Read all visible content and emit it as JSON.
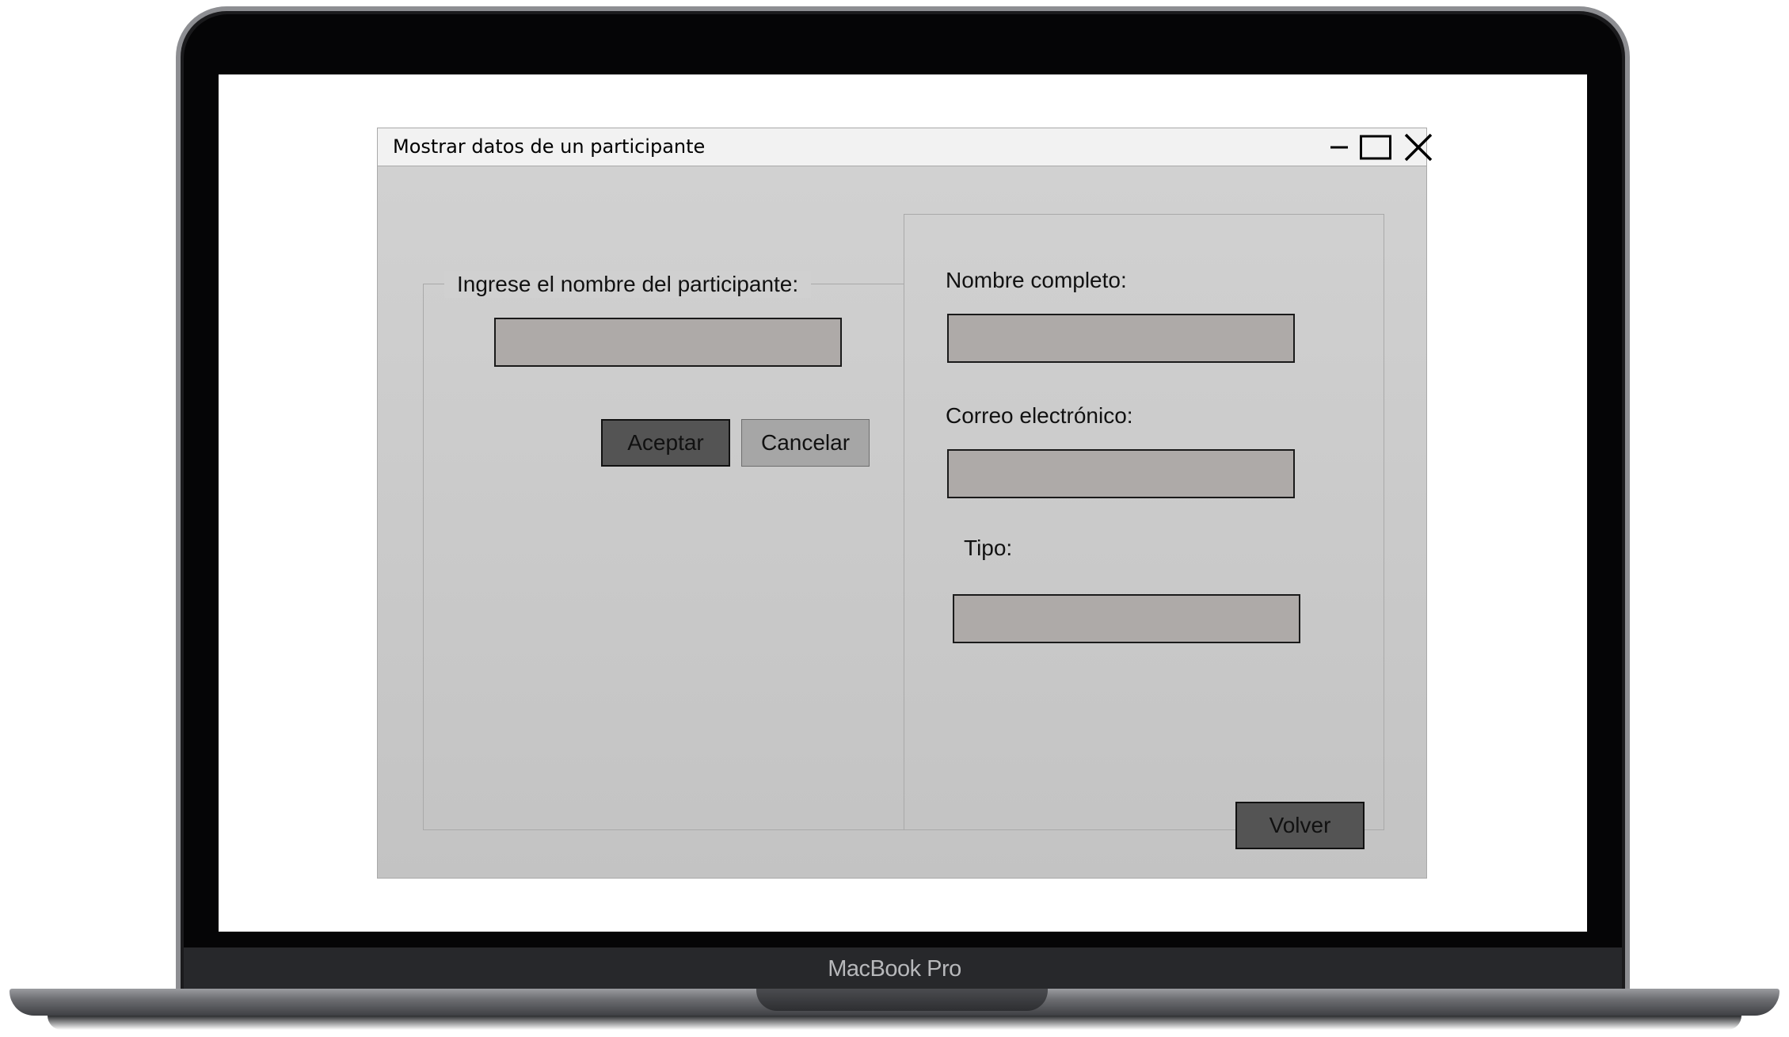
{
  "device": {
    "brand_label": "MacBook Pro"
  },
  "window": {
    "title": "Mostrar datos de un participante"
  },
  "search_panel": {
    "legend": "Ingrese el nombre del participante:",
    "input_value": "",
    "accept_label": "Aceptar",
    "cancel_label": "Cancelar"
  },
  "details_panel": {
    "fullname_label": "Nombre completo:",
    "fullname_value": "",
    "email_label": "Correo electrónico:",
    "email_value": "",
    "type_label": "Tipo:",
    "type_value": "",
    "back_label": "Volver"
  },
  "colors": {
    "field_bg": "#aeaaa8",
    "dark_button": "#545454",
    "light_button": "#a6a6a6",
    "titlebar": "#f2f2f2"
  }
}
